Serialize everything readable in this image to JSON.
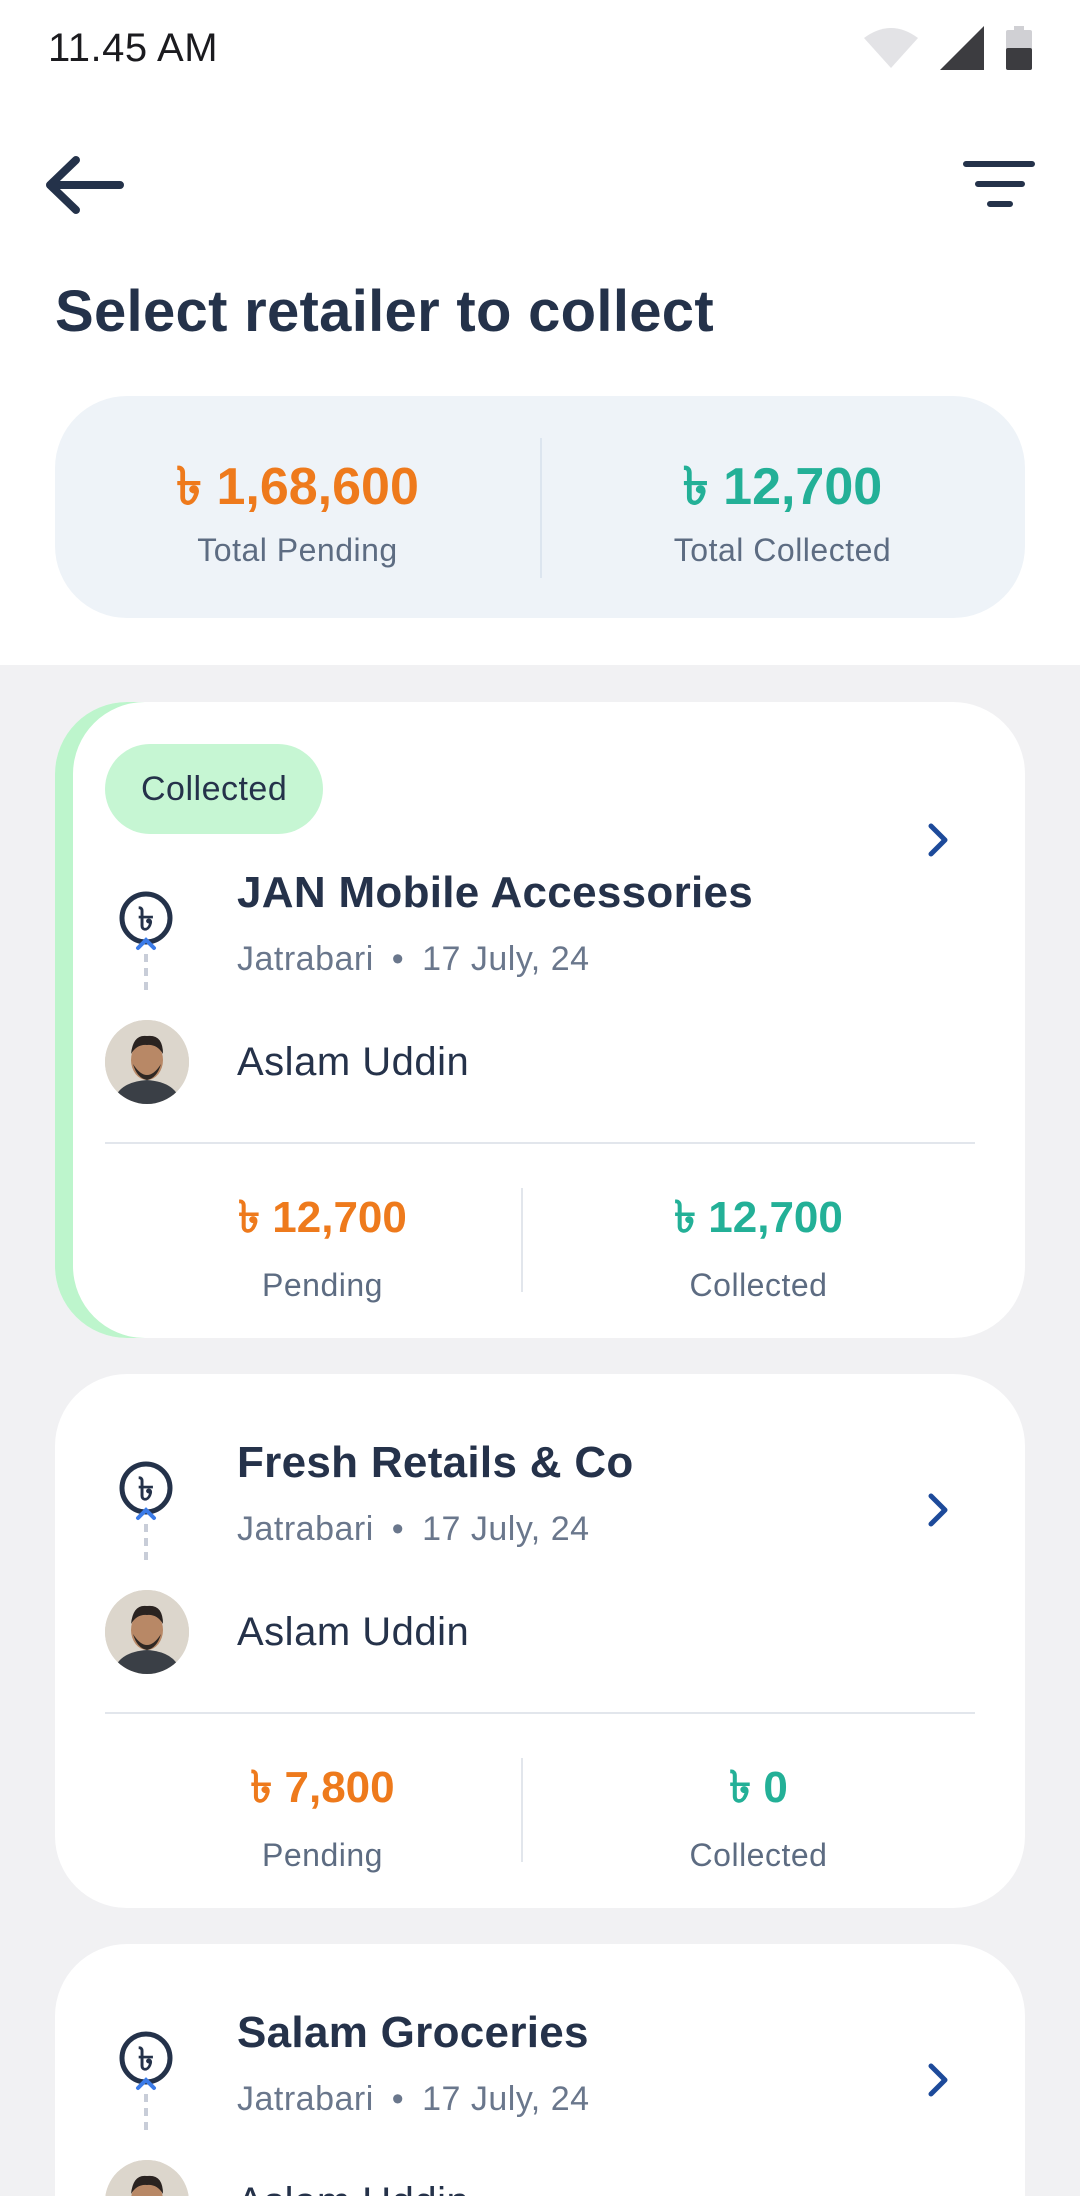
{
  "status_bar": {
    "time": "11.45 AM"
  },
  "header": {
    "title": "Select retailer to collect"
  },
  "summary": {
    "pending_amount": "৳ 1,68,600",
    "pending_label": "Total Pending",
    "collected_amount": "৳ 12,700",
    "collected_label": "Total Collected"
  },
  "colors": {
    "pending": "#ee7a1c",
    "collected": "#23b097",
    "badge": "#c6f6d3",
    "accent": "#bdf5cc",
    "title": "#24324a"
  },
  "retailers": [
    {
      "badge": "Collected",
      "name": "JAN Mobile Accessories",
      "area": "Jatrabari",
      "date": "17 July, 24",
      "separator": "•",
      "person": "Aslam Uddin",
      "pending": "৳ 12,700",
      "pending_label": "Pending",
      "collected": "৳ 12,700",
      "collected_label": "Collected"
    },
    {
      "name": "Fresh Retails & Co",
      "area": "Jatrabari",
      "date": "17 July, 24",
      "separator": "•",
      "person": "Aslam Uddin",
      "pending": "৳ 7,800",
      "pending_label": "Pending",
      "collected": "৳ 0",
      "collected_label": "Collected"
    },
    {
      "name": "Salam Groceries",
      "area": "Jatrabari",
      "date": "17 July, 24",
      "separator": "•",
      "person": "Aslam Uddin"
    }
  ]
}
